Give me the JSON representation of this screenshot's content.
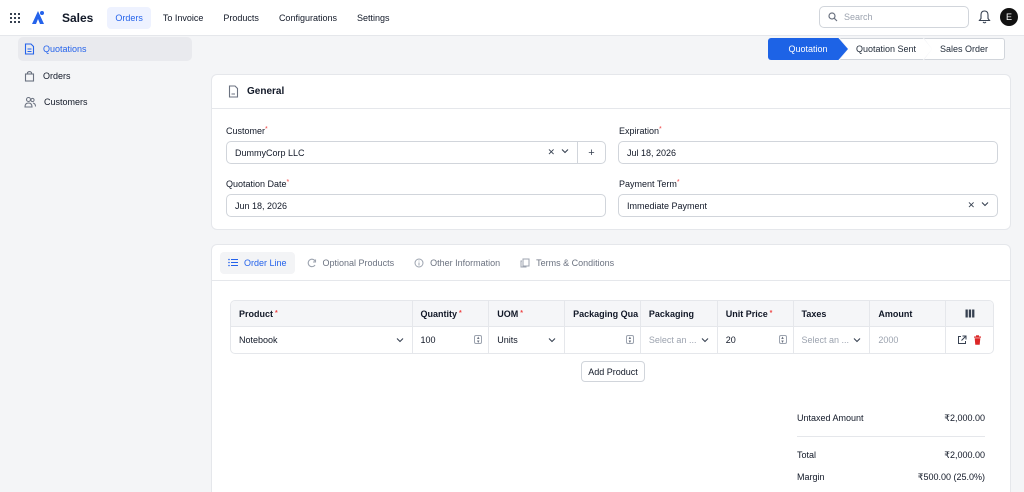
{
  "app": {
    "name": "Sales",
    "user_initial": "E"
  },
  "nav": [
    "Orders",
    "To Invoice",
    "Products",
    "Configurations",
    "Settings"
  ],
  "search": {
    "placeholder": "Search"
  },
  "sidebar": {
    "items": [
      {
        "label": "Quotations",
        "icon": "document-icon",
        "active": true
      },
      {
        "label": "Orders",
        "icon": "shopping-bag-icon",
        "active": false
      },
      {
        "label": "Customers",
        "icon": "users-icon",
        "active": false
      }
    ]
  },
  "stages": [
    "Quotation",
    "Quotation Sent",
    "Sales Order"
  ],
  "general": {
    "title": "General",
    "customer_label": "Customer",
    "customer_value": "DummyCorp LLC",
    "expiration_label": "Expiration",
    "expiration_value": "Jul 18, 2026",
    "quotation_date_label": "Quotation Date",
    "quotation_date_value": "Jun 18, 2026",
    "payment_term_label": "Payment Term",
    "payment_term_value": "Immediate Payment"
  },
  "tabs": [
    "Order Line",
    "Optional Products",
    "Other Information",
    "Terms & Conditions"
  ],
  "table": {
    "columns": [
      "Product",
      "Quantity",
      "UOM",
      "Packaging Qua",
      "Packaging",
      "Unit Price",
      "Taxes",
      "Amount"
    ],
    "row": {
      "product": "Notebook",
      "quantity": "100",
      "uom": "Units",
      "packaging_qty": "",
      "packaging": "Select an ...",
      "unit_price": "20",
      "taxes": "Select an ...",
      "amount": "2000"
    },
    "add_label": "Add Product"
  },
  "totals": {
    "untaxed_label": "Untaxed Amount",
    "untaxed_value": "₹2,000.00",
    "total_label": "Total",
    "total_value": "₹2,000.00",
    "margin_label": "Margin",
    "margin_value": "₹500.00 (25.0%)"
  },
  "colors": {
    "accent": "#1d63e6",
    "required": "#ef4444",
    "delete": "#dc2626"
  }
}
